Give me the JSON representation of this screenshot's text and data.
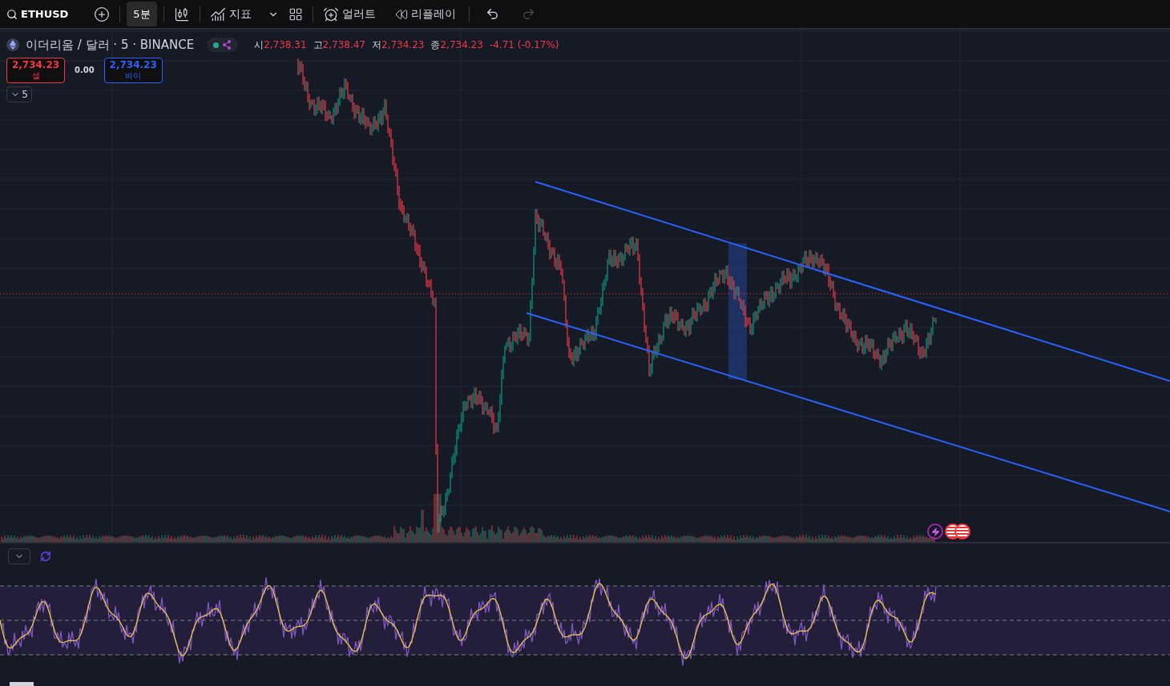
{
  "toolbar": {
    "symbol": "ETHUSD",
    "interval": {
      "label": "5분",
      "selected": true
    },
    "indicators": "지표",
    "alerts": "얼러트",
    "replay": "리플레이",
    "undo": {
      "disabled": false
    },
    "redo": {
      "disabled": true
    }
  },
  "legend": {
    "title": "이더리움 / 달러 · 5 · BINANCE",
    "ohlc": [
      {
        "label": "시",
        "value": "2,738.31"
      },
      {
        "label": "고",
        "value": "2,738.47"
      },
      {
        "label": "저",
        "value": "2,734.23"
      },
      {
        "label": "종",
        "value": "2,734.23"
      }
    ],
    "change": "-4.71 (-0.17%)"
  },
  "trade": {
    "sell": {
      "price": "2,734.23",
      "label": "셀"
    },
    "spread": "0.00",
    "buy": {
      "price": "2,734.23",
      "label": "바이"
    }
  },
  "series_toggle": "5"
}
